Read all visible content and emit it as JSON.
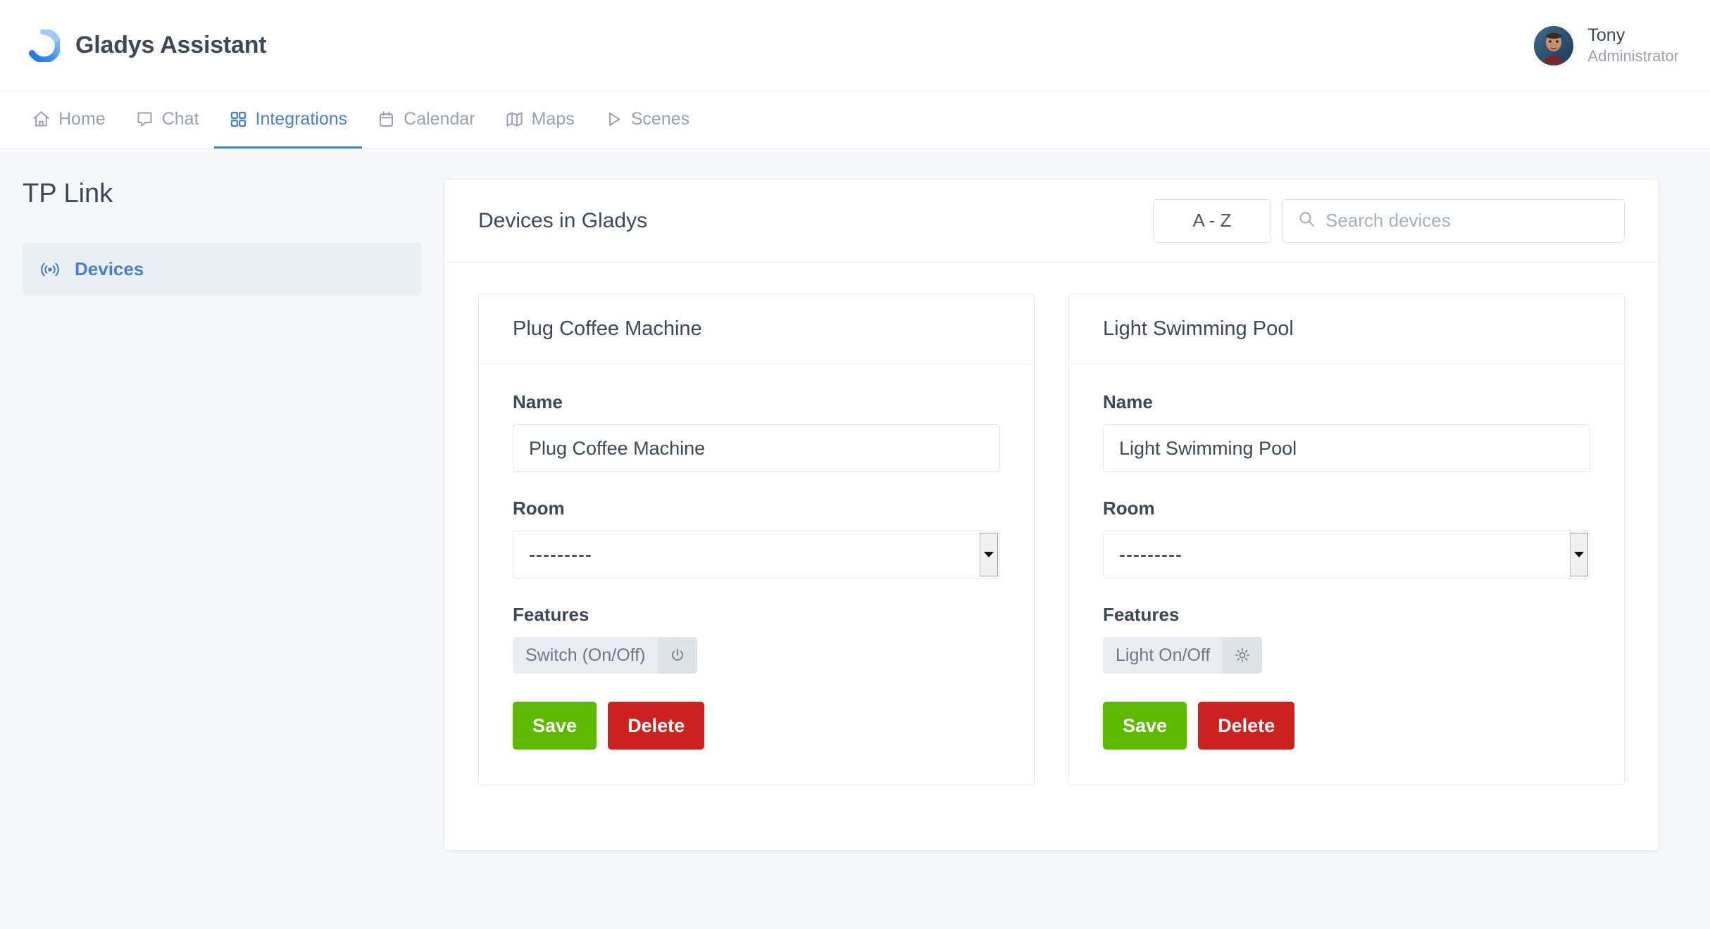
{
  "header": {
    "brand_title": "Gladys Assistant",
    "logo_icon": "gladys-ring-logo",
    "user": {
      "name": "Tony",
      "role": "Administrator",
      "avatar_icon": "user-avatar-photo"
    }
  },
  "nav": {
    "items": [
      {
        "label": "Home",
        "icon": "home-icon",
        "active": false
      },
      {
        "label": "Chat",
        "icon": "chat-bubble-icon",
        "active": false
      },
      {
        "label": "Integrations",
        "icon": "grid-squares-icon",
        "active": true
      },
      {
        "label": "Calendar",
        "icon": "calendar-icon",
        "active": false
      },
      {
        "label": "Maps",
        "icon": "map-icon",
        "active": false
      },
      {
        "label": "Scenes",
        "icon": "play-triangle-icon",
        "active": false
      }
    ]
  },
  "sidebar": {
    "title": "TP Link",
    "items": [
      {
        "label": "Devices",
        "icon": "broadcast-signal-icon",
        "active": true
      }
    ]
  },
  "panel": {
    "title": "Devices in Gladys",
    "sort_button_label": "A - Z",
    "search": {
      "icon": "search-icon",
      "placeholder": "Search devices",
      "value": ""
    },
    "devices": [
      {
        "card_title": "Plug Coffee Machine",
        "name_label": "Name",
        "name_value": "Plug Coffee Machine",
        "room_label": "Room",
        "room_value": "---------",
        "features_label": "Features",
        "features": [
          {
            "label": "Switch (On/Off)",
            "icon": "power-icon"
          }
        ],
        "save_label": "Save",
        "delete_label": "Delete"
      },
      {
        "card_title": "Light Swimming Pool",
        "name_label": "Name",
        "name_value": "Light Swimming Pool",
        "room_label": "Room",
        "room_value": "---------",
        "features_label": "Features",
        "features": [
          {
            "label": "Light On/Off",
            "icon": "sun-brightness-icon"
          }
        ],
        "save_label": "Save",
        "delete_label": "Delete"
      }
    ]
  },
  "colors": {
    "accent": "#467fcf",
    "save_green": "#5eba00",
    "delete_red": "#cd201f",
    "page_bg": "#f5f7fb",
    "text_dark": "#3c4858",
    "text_muted": "#9aa0ac"
  }
}
